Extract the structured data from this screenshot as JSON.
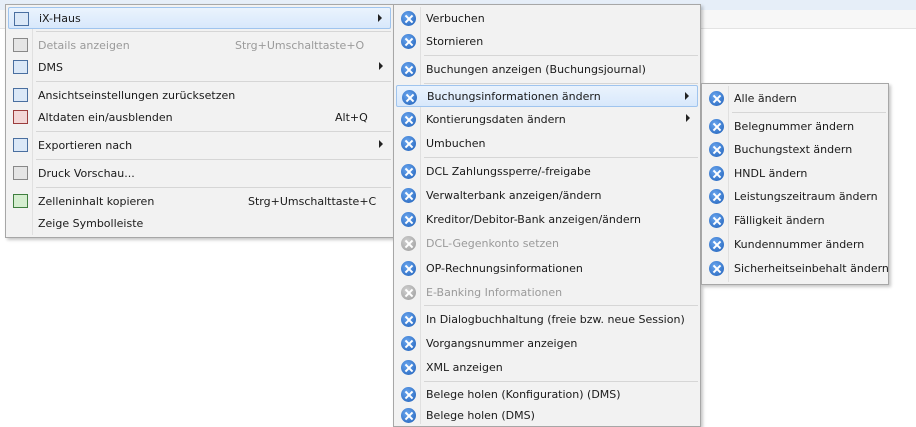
{
  "menu1": {
    "items": [
      {
        "label": "iX-Haus",
        "icon": "ixhaus-icon",
        "submenu": true,
        "highlight": true
      },
      {
        "label": "Details anzeigen",
        "shortcut": "Strg+Umschalttaste+O",
        "icon": "details-icon",
        "disabled": true
      },
      {
        "label": "DMS",
        "icon": "dms-icon",
        "submenu": true
      },
      {
        "label": "Ansichtseinstellungen zurücksetzen",
        "icon": "reset-view-icon"
      },
      {
        "label": "Altdaten ein/ausblenden",
        "shortcut": "Alt+Q",
        "icon": "altdaten-icon"
      },
      {
        "label": "Exportieren nach",
        "icon": "export-icon",
        "submenu": true
      },
      {
        "label": "Druck Vorschau...",
        "icon": "print-preview-icon"
      },
      {
        "label": "Zelleninhalt kopieren",
        "shortcut": "Strg+Umschalttaste+C",
        "icon": "copy-cell-icon"
      },
      {
        "label": "Zeige Symbolleiste",
        "icon": ""
      }
    ]
  },
  "menu2": {
    "items": [
      {
        "label": "Verbuchen"
      },
      {
        "label": "Stornieren"
      },
      {
        "label": "Buchungen anzeigen (Buchungsjournal)"
      },
      {
        "label": "Buchungsinformationen ändern",
        "submenu": true,
        "highlight": true
      },
      {
        "label": "Kontierungsdaten ändern",
        "submenu": true
      },
      {
        "label": "Umbuchen"
      },
      {
        "label": "DCL Zahlungssperre/-freigabe"
      },
      {
        "label": "Verwalterbank anzeigen/ändern"
      },
      {
        "label": "Kreditor/Debitor-Bank anzeigen/ändern"
      },
      {
        "label": "DCL-Gegenkonto setzen",
        "disabled": true
      },
      {
        "label": "OP-Rechnungsinformationen"
      },
      {
        "label": "E-Banking Informationen",
        "disabled": true
      },
      {
        "label": "In Dialogbuchhaltung (freie bzw. neue Session)"
      },
      {
        "label": "Vorgangsnummer anzeigen"
      },
      {
        "label": "XML anzeigen"
      },
      {
        "label": "Belege holen (Konfiguration) (DMS)"
      },
      {
        "label": "Belege holen (DMS)"
      }
    ]
  },
  "menu3": {
    "items": [
      {
        "label": "Alle ändern"
      },
      {
        "label": "Belegnummer ändern"
      },
      {
        "label": "Buchungstext ändern"
      },
      {
        "label": "HNDL ändern"
      },
      {
        "label": "Leistungszeitraum ändern"
      },
      {
        "label": "Fälligkeit ändern"
      },
      {
        "label": "Kundennummer ändern"
      },
      {
        "label": "Sicherheitseinbehalt ändern"
      }
    ]
  }
}
